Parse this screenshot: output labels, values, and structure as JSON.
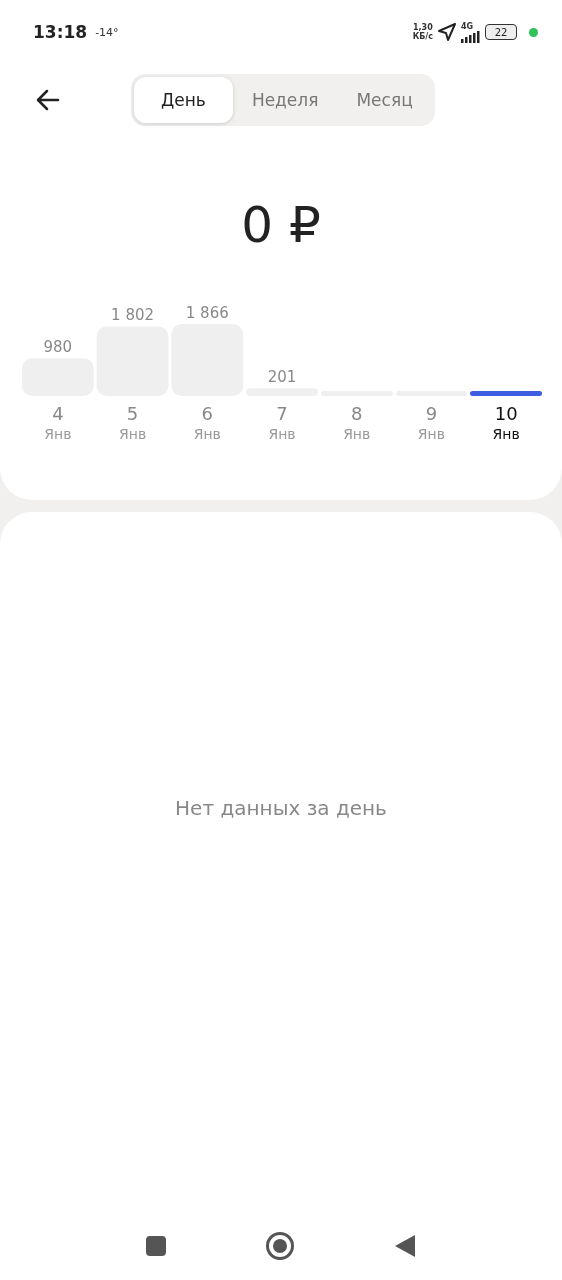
{
  "status_bar": {
    "time": "13:18",
    "temperature": "-14°",
    "speed": "1,30",
    "speed_unit": "КБ/с",
    "network": "4G",
    "battery": "22"
  },
  "tabs": [
    {
      "label": "День",
      "selected": true
    },
    {
      "label": "Неделя",
      "selected": false
    },
    {
      "label": "Месяц",
      "selected": false
    }
  ],
  "total": "0 ₽",
  "chart_data": {
    "type": "bar",
    "categories": [
      "4",
      "5",
      "6",
      "7",
      "8",
      "9",
      "10"
    ],
    "values": [
      980,
      1802,
      1866,
      201,
      0,
      0,
      0
    ],
    "value_labels": [
      "980",
      "1 802",
      "1 866",
      "201",
      null,
      null,
      null
    ]
  },
  "days": [
    {
      "month": "Янв",
      "selected": false
    },
    {
      "month": "Янв",
      "selected": false
    },
    {
      "month": "Янв",
      "selected": false
    },
    {
      "month": "Янв",
      "selected": false
    },
    {
      "month": "Янв",
      "selected": false
    },
    {
      "month": "Янв",
      "selected": false
    },
    {
      "month": "Янв",
      "selected": true
    }
  ],
  "empty_message": "Нет данных за день"
}
